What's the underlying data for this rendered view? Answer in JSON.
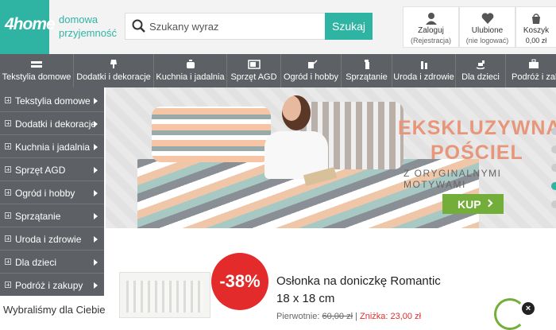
{
  "header": {
    "logo": "4home",
    "tagline": "domowa przyjemność",
    "search_placeholder": "Szukany wyraz",
    "search_button": "Szukaj",
    "login": {
      "label": "Zaloguj",
      "sub": "(Rejestracja)"
    },
    "favorites": {
      "label": "Ulubione",
      "sub": "(nie logować)"
    },
    "cart": {
      "label": "Koszyk",
      "sub": "0,00 zł"
    }
  },
  "categories": [
    {
      "label": "Tekstylia domowe",
      "icon": "textiles-icon"
    },
    {
      "label": "Dodatki i dekoracje",
      "icon": "lamp-icon"
    },
    {
      "label": "Kuchnia i jadalnia",
      "icon": "pot-icon"
    },
    {
      "label": "Sprzęt AGD",
      "icon": "microwave-icon"
    },
    {
      "label": "Ogród i hobby",
      "icon": "watering-can-icon"
    },
    {
      "label": "Sprzątanie",
      "icon": "spray-icon"
    },
    {
      "label": "Uroda i zdrowie",
      "icon": "cosmetics-icon"
    },
    {
      "label": "Dla dzieci",
      "icon": "rocking-horse-icon"
    },
    {
      "label": "Podróż i zakupy",
      "icon": "suitcase-icon"
    }
  ],
  "sidebar": {
    "items": [
      "Tekstylia domowe",
      "Dodatki i dekoracje",
      "Kuchnia i jadalnia",
      "Sprzęt AGD",
      "Ogród i hobby",
      "Sprzątanie",
      "Uroda i zdrowie",
      "Dla dzieci",
      "Podróż i zakupy"
    ],
    "picked_heading": "Wybraliśmy dla Ciebie"
  },
  "banner": {
    "title_line1": "EKSKLUZYWNA",
    "title_line2": "POŚCIEL",
    "subtitle": "Z ORYGINALNYMI MOTYWAMI",
    "button": "KUP",
    "slide_count": 5,
    "active_slide": 4
  },
  "product": {
    "discount": "-38%",
    "title": "Osłonka na doniczkę Romantic",
    "size": "18 x 18 cm",
    "price_label": "Pierwotnie: ",
    "old_price": "60,00 zł",
    "new_price": "Zniżka: 23,00 zł"
  },
  "colors": {
    "brand": "#2fb4a4",
    "nav_bg": "#5d6064",
    "discount": "#e32b2b",
    "cta": "#74ae3a"
  }
}
